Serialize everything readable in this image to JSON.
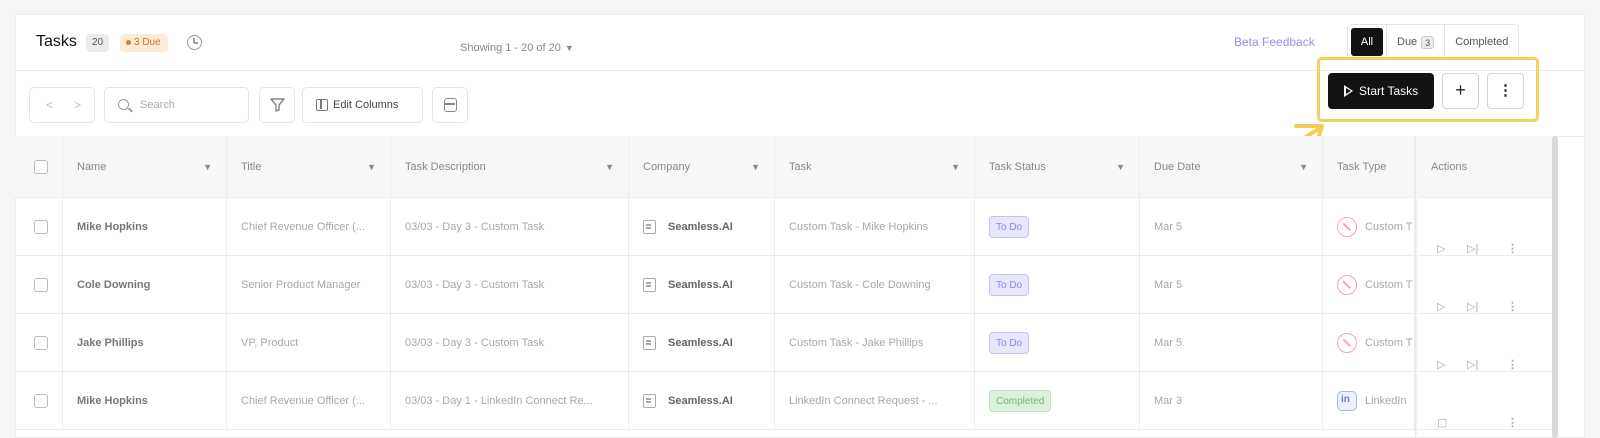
{
  "header": {
    "title": "Tasks",
    "count": "20",
    "due_badge": "3 Due",
    "beta_link": "Beta Feedback",
    "filter_tabs": {
      "all": "All",
      "due": "Due",
      "due_count": "3",
      "completed": "Completed"
    }
  },
  "toolbar": {
    "prev_icon": "<",
    "next_icon": ">",
    "search_placeholder": "Search",
    "edit_columns": "Edit Columns",
    "showing": "Showing 1 - 20 of 20",
    "start_tasks": "Start Tasks",
    "add": "+",
    "more": "⋮"
  },
  "table": {
    "columns": [
      "Name",
      "Title",
      "Task Description",
      "Company",
      "Task",
      "Task Status",
      "Due Date",
      "Task Type",
      "Actions"
    ],
    "rows": [
      {
        "name": "Mike Hopkins",
        "title": "Chief Revenue Officer (...",
        "description": "03/03 - Day 3 - Custom Task",
        "company": "Seamless.AI",
        "task": "Custom Task - Mike Hopkins",
        "status": "To Do",
        "due": "Mar 5",
        "type": "Custom T"
      },
      {
        "name": "Cole Downing",
        "title": "Senior Product Manager",
        "description": "03/03 - Day 3 - Custom Task",
        "company": "Seamless.AI",
        "task": "Custom Task - Cole Downing",
        "status": "To Do",
        "due": "Mar 5",
        "type": "Custom T"
      },
      {
        "name": "Jake Phillips",
        "title": "VP, Product",
        "description": "03/03 - Day 3 - Custom Task",
        "company": "Seamless.AI",
        "task": "Custom Task - Jake Phillips",
        "status": "To Do",
        "due": "Mar 5",
        "type": "Custom T"
      },
      {
        "name": "Mike Hopkins",
        "title": "Chief Revenue Officer (...",
        "description": "03/03 - Day 1 - LinkedIn Connect Re...",
        "company": "Seamless.AI",
        "task": "LinkedIn Connect Request - ...",
        "status": "Completed",
        "due": "Mar 3",
        "type": "LinkedIn"
      }
    ]
  },
  "colors": {
    "accent_highlight": "#f2d15f",
    "primary_button": "#131313",
    "todo": "#8e87e6",
    "completed": "#7db37d"
  }
}
